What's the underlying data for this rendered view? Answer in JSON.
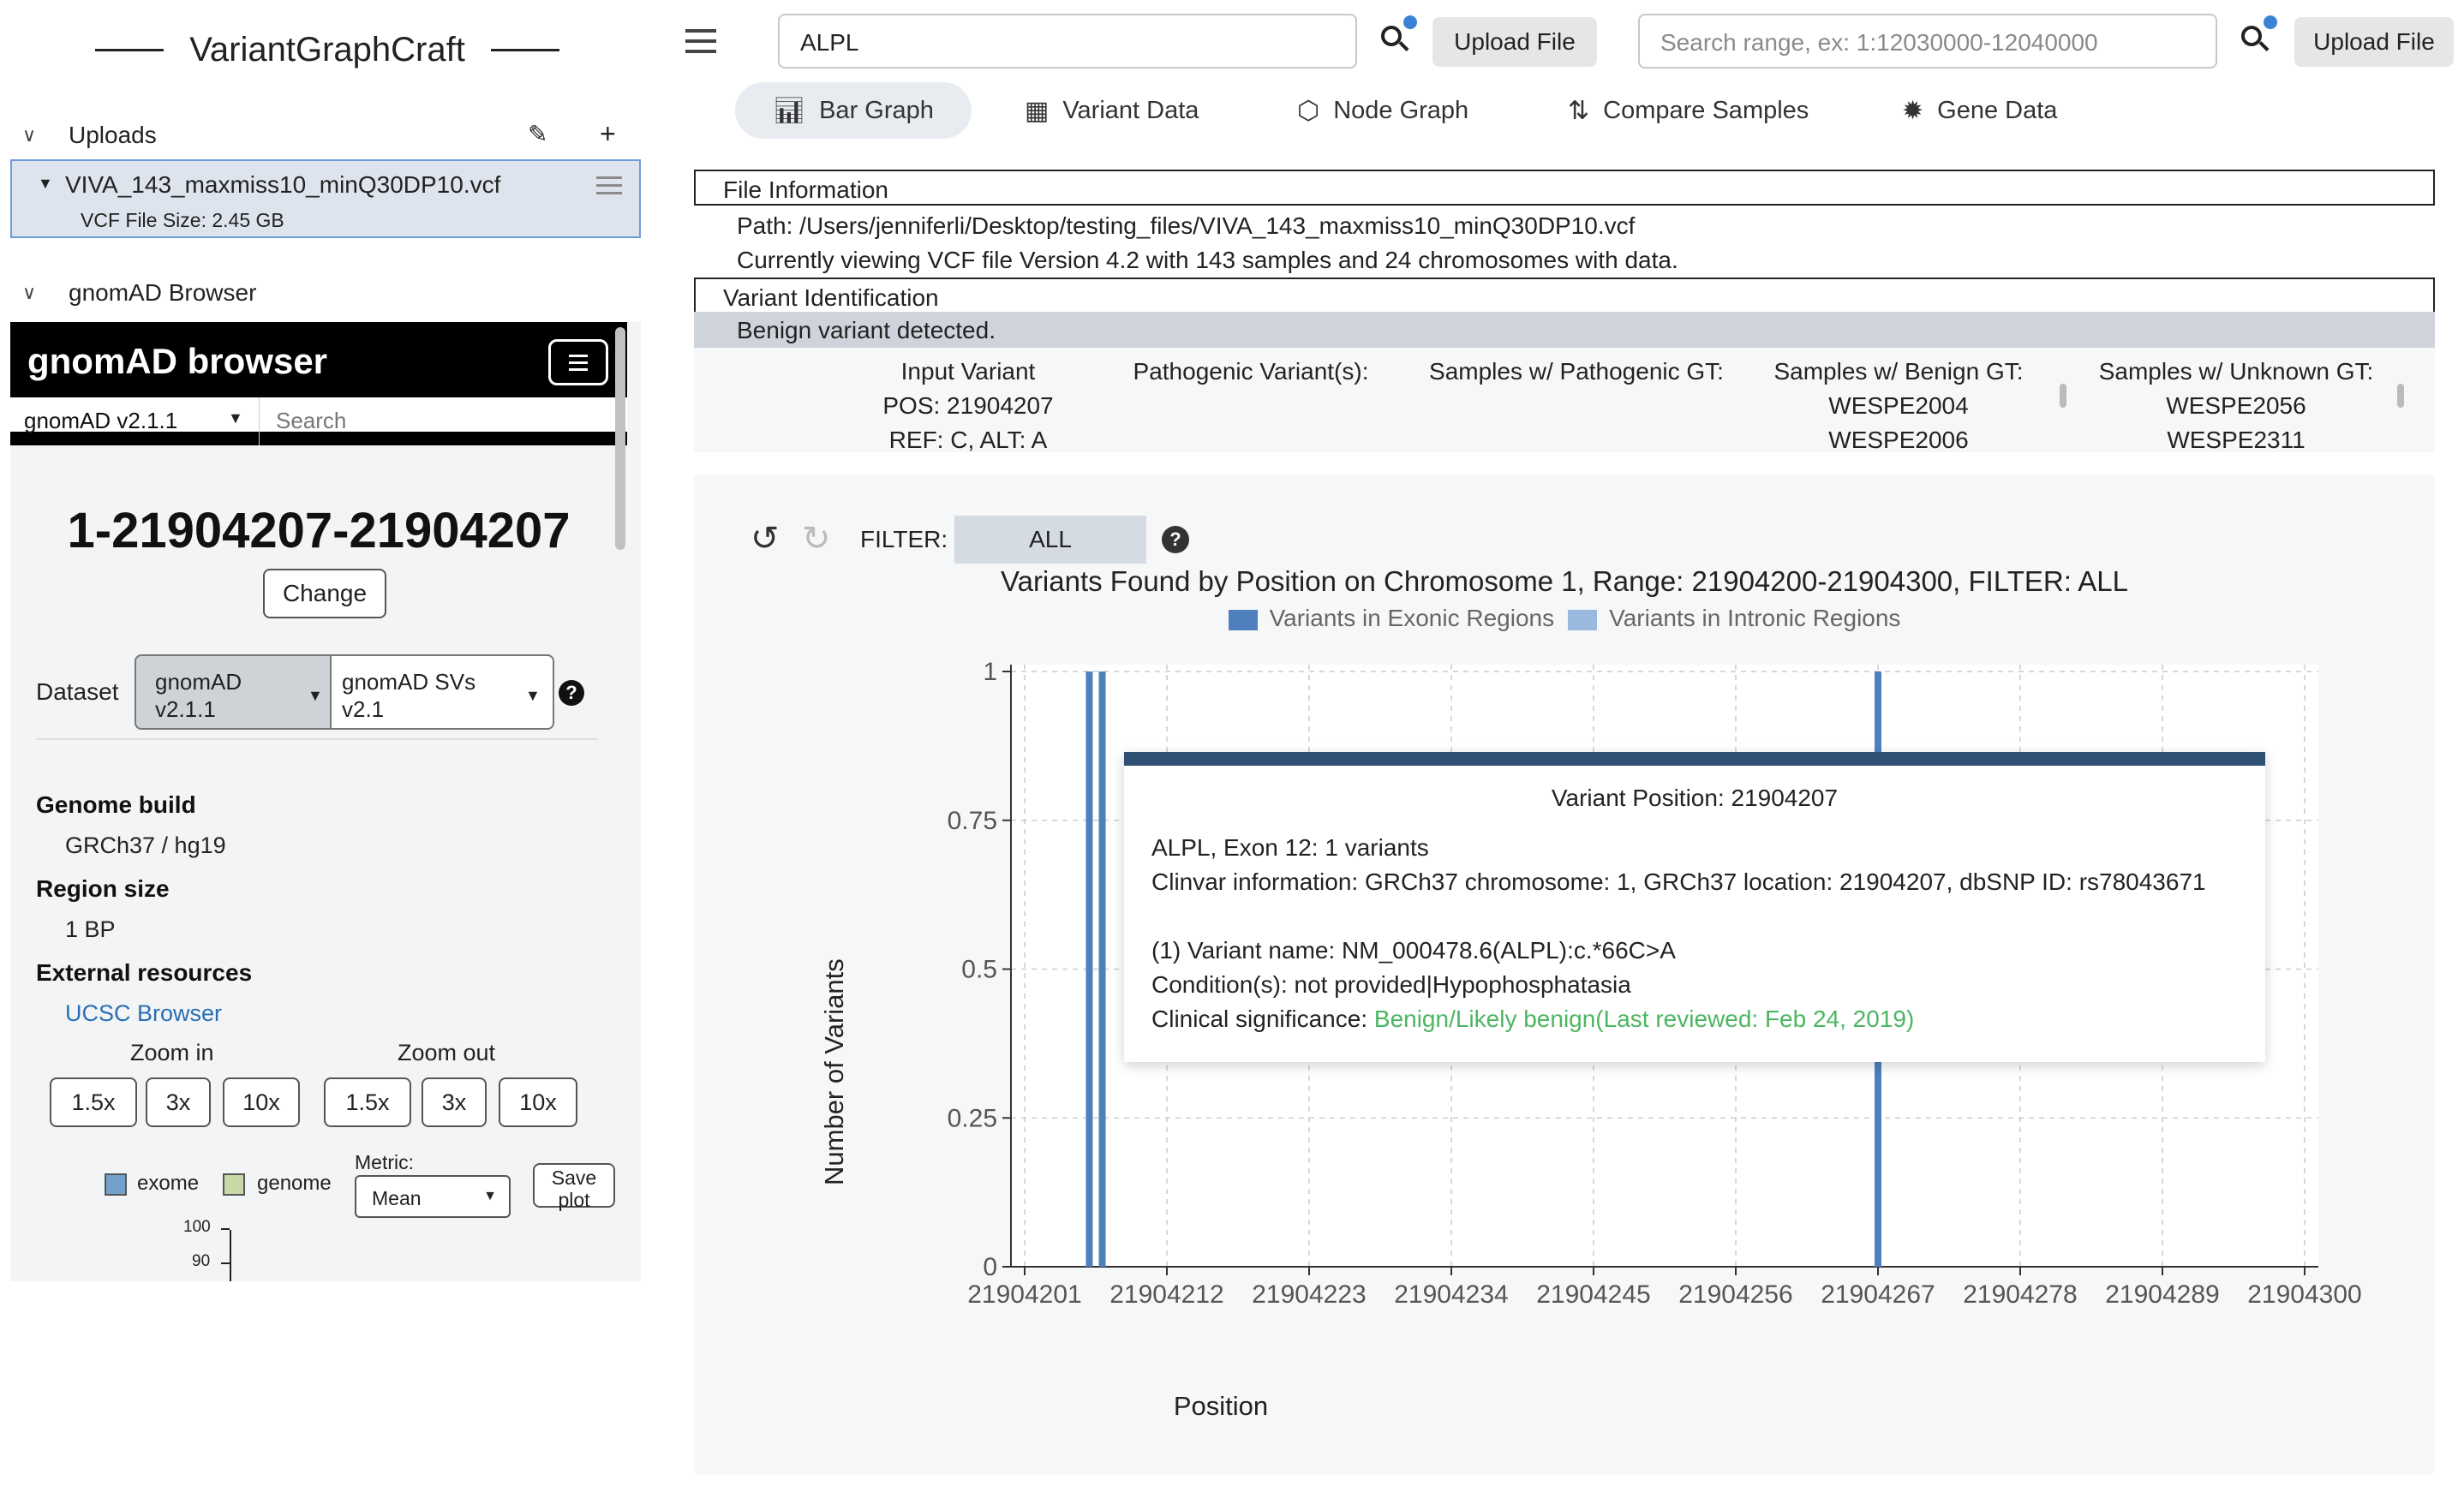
{
  "app": {
    "title": "VariantGraphCraft"
  },
  "sidebar": {
    "uploads_label": "Uploads",
    "upload_file_name": "VIVA_143_maxmiss10_minQ30DP10.vcf",
    "upload_file_size": "VCF File Size: 2.45 GB",
    "gnomad_section_label": "gnomAD Browser"
  },
  "gnomad": {
    "brand": "gnomAD browser",
    "dataset_selector": "gnomAD v2.1.1",
    "search_placeholder": "Search",
    "region": "1-21904207-21904207",
    "change_label": "Change",
    "dataset_label": "Dataset",
    "dataset_option_1": [
      "gnomAD",
      "v2.1.1"
    ],
    "dataset_option_2": [
      "gnomAD SVs",
      "v2.1"
    ],
    "genome_build_label": "Genome build",
    "genome_build_value": "GRCh37 / hg19",
    "region_size_label": "Region size",
    "region_size_value": "1 BP",
    "external_resources_label": "External resources",
    "ucsc_link": "UCSC Browser",
    "zoom_in_label": "Zoom in",
    "zoom_out_label": "Zoom out",
    "zoom_in_options": [
      "1.5x",
      "3x",
      "10x"
    ],
    "zoom_out_options": [
      "1.5x",
      "3x",
      "10x"
    ],
    "legend_exome": "exome",
    "legend_genome": "genome",
    "metric_label": "Metric:",
    "metric_value": "Mean",
    "save_plot": [
      "Save",
      "plot"
    ],
    "mini_ticks": [
      "100",
      "90"
    ],
    "colors": {
      "exome": "#73a0c8",
      "genome": "#c9d9a5"
    }
  },
  "topbar": {
    "gene_search_value": "ALPL",
    "range_search_placeholder": "Search range, ex: 1:12030000-12040000",
    "upload_file_label": "Upload File",
    "tabs": [
      {
        "label": "Bar Graph",
        "icon": "bar-chart-icon",
        "active": true
      },
      {
        "label": "Variant Data",
        "icon": "table-icon",
        "active": false
      },
      {
        "label": "Node Graph",
        "icon": "node-graph-icon",
        "active": false
      },
      {
        "label": "Compare Samples",
        "icon": "compare-icon",
        "active": false
      },
      {
        "label": "Gene Data",
        "icon": "gene-icon",
        "active": false
      }
    ]
  },
  "info": {
    "file_info_header": "File Information",
    "path": "Path: /Users/jenniferli/Desktop/testing_files/VIVA_143_maxmiss10_minQ30DP10.vcf",
    "version_line": "Currently viewing VCF file Version 4.2 with 143 samples and 24 chromosomes with data.",
    "variant_id_header": "Variant Identification",
    "benign_message": "Benign variant detected.",
    "columns": {
      "input_variant": {
        "header": "Input Variant",
        "lines": [
          "POS: 21904207",
          "REF: C, ALT: A"
        ]
      },
      "pathogenic_variants": {
        "header": "Pathogenic Variant(s):",
        "lines": []
      },
      "pathogenic_gt": {
        "header": "Samples w/ Pathogenic GT:",
        "lines": []
      },
      "benign_gt": {
        "header": "Samples w/ Benign GT:",
        "lines": [
          "WESPE2004",
          "WESPE2006"
        ]
      },
      "unknown_gt": {
        "header": "Samples w/ Unknown GT:",
        "lines": [
          "WESPE2056",
          "WESPE2311"
        ]
      }
    }
  },
  "graph": {
    "filter_label": "FILTER:",
    "filter_value": "ALL",
    "tooltip": {
      "header": "Variant Position: 21904207",
      "gene_line": "ALPL, Exon 12: 1 variants",
      "clinvar_line": "Clinvar information: GRCh37 chromosome: 1, GRCh37 location: 21904207, dbSNP ID: rs78043671",
      "variant_name": "(1) Variant name: NM_000478.6(ALPL):c.*66C>A",
      "conditions": "Condition(s): not provided|Hypophosphatasia",
      "sig_prefix": "Clinical significance: ",
      "sig_value": "Benign/Likely benign(Last reviewed: Feb 24, 2019)",
      "sig_color": "#4cb661"
    }
  },
  "chart_data": {
    "type": "bar",
    "title": "Variants Found by Position on Chromosome 1, Range: 21904200-21904300, FILTER: ALL",
    "xlabel": "Position",
    "ylabel": "Number of Variants",
    "xlim": [
      21904201,
      21904300
    ],
    "ylim": [
      0,
      1
    ],
    "x_ticks": [
      "21904201",
      "21904212",
      "21904223",
      "21904234",
      "21904245",
      "21904256",
      "21904267",
      "21904278",
      "21904289",
      "21904300"
    ],
    "y_ticks": [
      "0",
      "0.25",
      "0.5",
      "0.75",
      "1"
    ],
    "legend": "top-center",
    "grid": true,
    "series": [
      {
        "name": "Variants in Exonic Regions",
        "color": "#4e80bd",
        "x": [
          21904206,
          21904207,
          21904267
        ],
        "values": [
          1,
          1,
          1
        ]
      },
      {
        "name": "Variants in Intronic Regions",
        "color": "#9ab9df",
        "x": [],
        "values": []
      }
    ]
  }
}
